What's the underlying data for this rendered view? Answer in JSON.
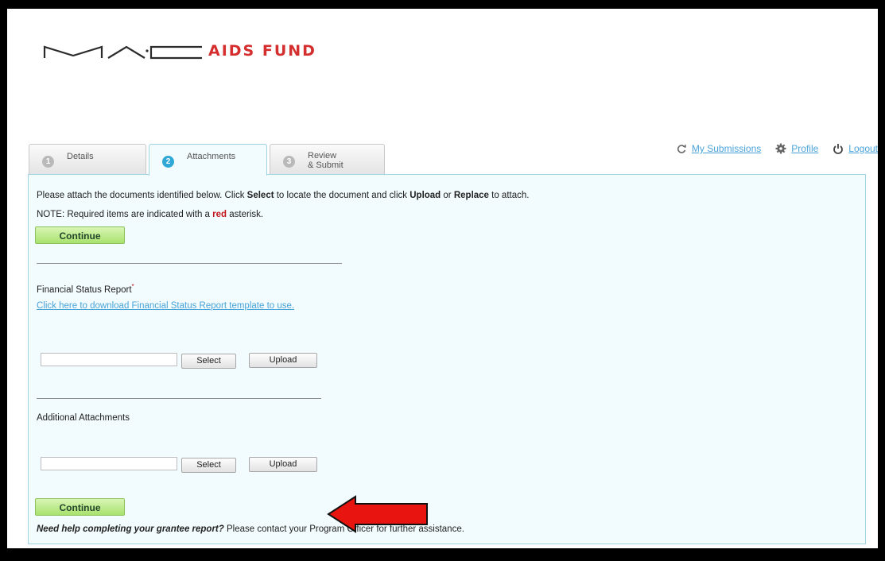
{
  "brand": {
    "logo_text": "AIDS FUND",
    "logo_mark": "MAC logo"
  },
  "nav": {
    "submissions": "My Submissions",
    "profile": "Profile",
    "logout": "Logout"
  },
  "tabs": [
    {
      "num": "1",
      "label": "Details"
    },
    {
      "num": "2",
      "label": "Attachments"
    },
    {
      "num": "3",
      "label_line1": "Review",
      "label_line2": "& Submit"
    }
  ],
  "instructions": {
    "part1": "Please attach the documents identified below. Click ",
    "select": "Select",
    "part2": " to locate the document and click ",
    "upload": "Upload",
    "or": " or ",
    "replace": "Replace",
    "part3": " to attach.",
    "note1": "NOTE: Required items are indicated with a ",
    "note_red": "red",
    "note2": " asterisk."
  },
  "buttons": {
    "continue": "Continue",
    "select": "Select",
    "upload": "Upload"
  },
  "sections": {
    "financial": {
      "label": "Financial Status Report",
      "required": "*",
      "template_link": "Click here to download Financial Status Report template to use."
    },
    "additional": {
      "label": "Additional Attachments"
    }
  },
  "help": {
    "bold": "Need help completing your grantee report?",
    "rest": " Please contact your Program Officer for further assistance."
  },
  "colors": {
    "accent": "#4aa3d8",
    "brand_red": "#d42e2e",
    "arrow": "#e8140f",
    "panel_bg": "#f2fbfd"
  }
}
